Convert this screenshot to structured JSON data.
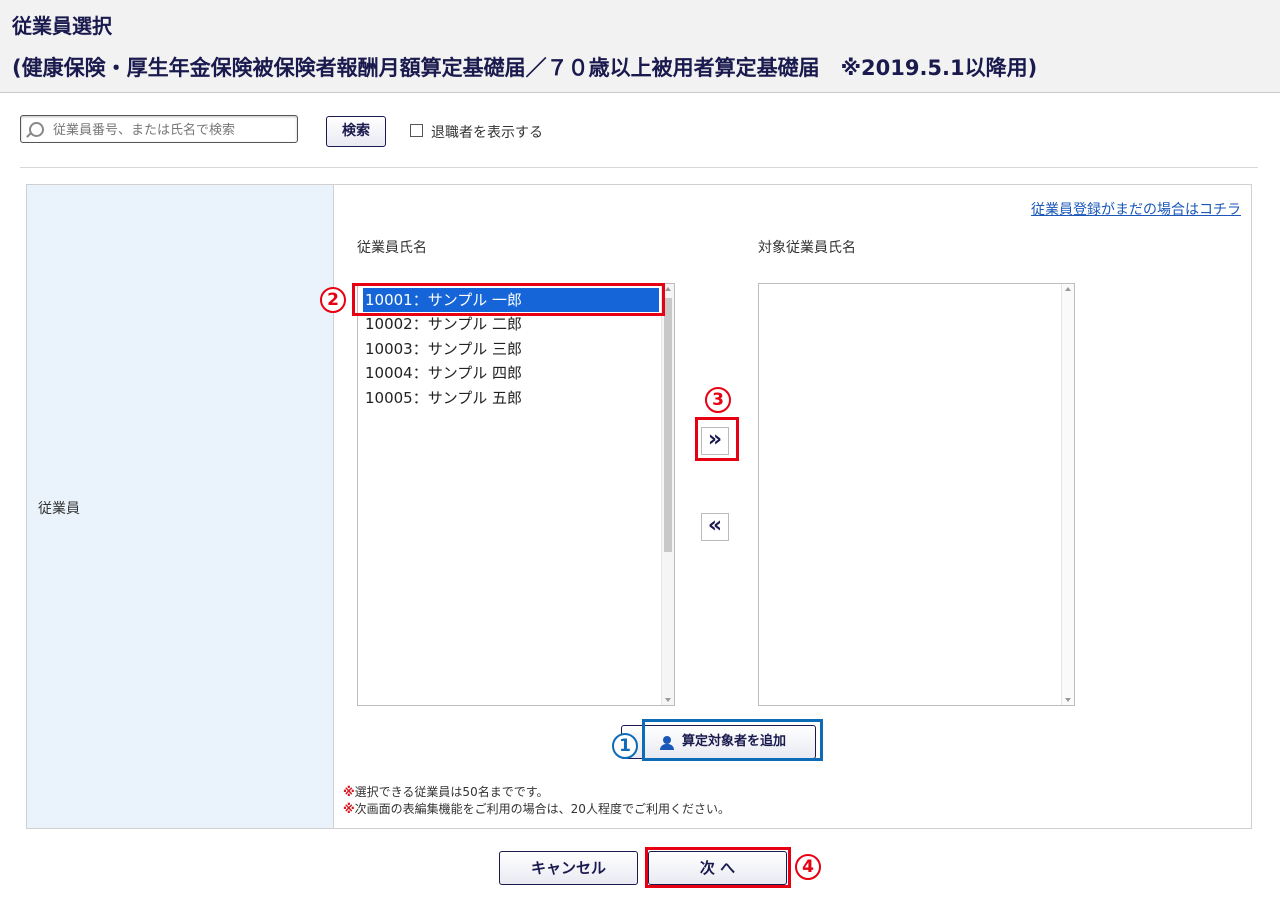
{
  "header": {
    "title": "従業員選択",
    "subtitle": "(健康保険・厚生年金保険被保険者報酬月額算定基礎届／７０歳以上被用者算定基礎届　※2019.5.1以降用)"
  },
  "search": {
    "placeholder": "従業員番号、または氏名で検索",
    "value": "",
    "button_label": "検索",
    "show_retired_label": "退職者を表示する",
    "show_retired_checked": false
  },
  "form": {
    "row_label": "従業員",
    "register_link": "従業員登録がまだの場合はコチラ",
    "left_list_header": "従業員氏名",
    "right_list_header": "対象従業員氏名",
    "employees": [
      {
        "label": "10001：サンプル 一郎",
        "selected": true
      },
      {
        "label": "10002：サンプル 二郎",
        "selected": false
      },
      {
        "label": "10003：サンプル 三郎",
        "selected": false
      },
      {
        "label": "10004：サンプル 四郎",
        "selected": false
      },
      {
        "label": "10005：サンプル 五郎",
        "selected": false
      }
    ],
    "target_employees": [],
    "move_right_label": "»",
    "move_left_label": "«",
    "add_button_label": "算定対象者を追加",
    "notes": [
      {
        "mark": "※",
        "text": "選択できる従業員は50名までです。"
      },
      {
        "mark": "※",
        "text": "次画面の表編集機能をご利用の場合は、20人程度でご利用ください。"
      }
    ]
  },
  "footer": {
    "cancel_label": "キャンセル",
    "next_label": "次 へ"
  },
  "annotations": {
    "step1": "1",
    "step2": "2",
    "step3": "3",
    "step4": "4"
  },
  "colors": {
    "title": "#1a1a4e",
    "label_cell_bg": "#eaf3fc",
    "selection": "#1565d8",
    "highlight_red": "#e60012",
    "highlight_blue": "#0d6bb8",
    "link": "#1a57b8"
  }
}
